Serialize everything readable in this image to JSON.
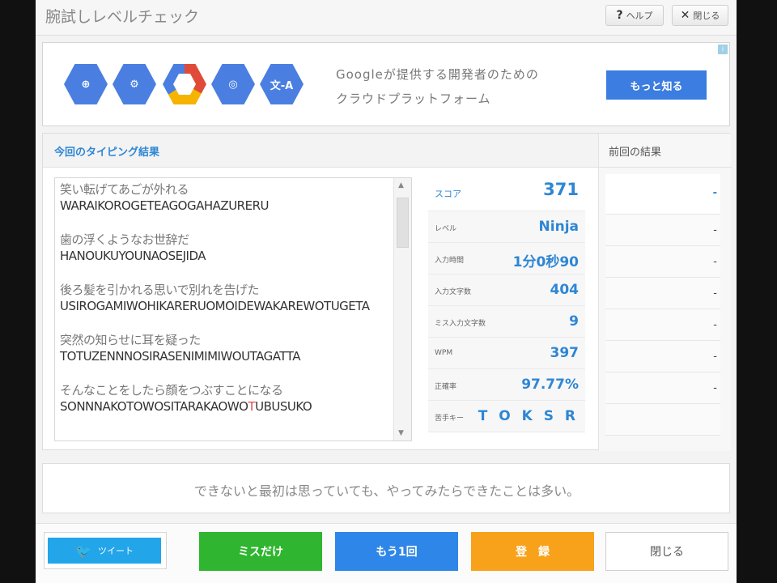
{
  "header": {
    "title": "腕試しレベルチェック",
    "help_label": "ヘルプ",
    "help_icon": "?",
    "close_label": "閉じる",
    "close_icon": "✕"
  },
  "ad": {
    "text_line1": "Googleが提供する開発者のための",
    "text_line2": "クラウドプラットフォーム",
    "button_label": "もっと知る",
    "icon_label": "文-A",
    "colors": {
      "button": "#3b7de0",
      "hex": "#4a7fe1"
    }
  },
  "current": {
    "tab_label": "今回のタイピング結果",
    "lyrics": [
      {
        "jp": "笑い転げてあごが外れる",
        "romaji": "WARAIKOROGETEAGOGAHAZURERU"
      },
      {
        "jp": "歯の浮くようなお世辞だ",
        "romaji": "HANOUKUYOUNAOSEJIDA"
      },
      {
        "jp": "後ろ髪を引かれる思いで別れを告げた",
        "romaji": "USIROGAMIWOHIKARERUOMOIDEWAKAREWOTUGETA"
      },
      {
        "jp": "突然の知らせに耳を疑った",
        "romaji": "TOTUZENNNOSIRASENIMIMIWOUTAGATTA"
      },
      {
        "jp": "そんなことをしたら顔をつぶすことになる",
        "romaji_before": "SONNNAKOTOWOSITARAKAOWO",
        "romaji_miss": "T",
        "romaji_after": "UBUSUKO"
      }
    ],
    "stats": {
      "score_label": "スコア",
      "score": "371",
      "level_label": "レベル",
      "level": "Ninja",
      "time_label": "入力時間",
      "time": "1分0秒90",
      "chars_label": "入力文字数",
      "chars": "404",
      "miss_label": "ミス入力文字数",
      "miss": "9",
      "wpm_label": "WPM",
      "wpm": "397",
      "accuracy_label": "正確率",
      "accuracy": "97.77%",
      "weak_label": "苦手キー",
      "weak": "T O K S R"
    }
  },
  "previous": {
    "title": "前回の結果",
    "values": [
      "-",
      "-",
      "-",
      "-",
      "-",
      "-",
      "-",
      ""
    ]
  },
  "quote": "できないと最初は思っていても、やってみたらできたことは多い。",
  "footer": {
    "tweet_label": "ツイート",
    "miss_only_label": "ミスだけ",
    "retry_label": "もう1回",
    "register_label": "登　録",
    "close_label": "閉じる",
    "colors": {
      "tweet": "#23a5ea",
      "miss_only": "#2fb52f",
      "retry": "#2e86e8",
      "register": "#f7a21a"
    }
  }
}
